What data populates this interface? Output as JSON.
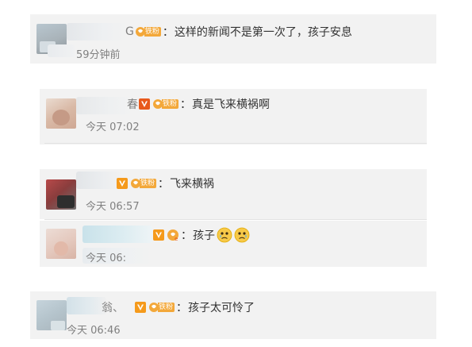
{
  "comments": [
    {
      "name_tail": "G",
      "text": "这样的新闻不是第一次了，孩子安息",
      "time": "59分钟前"
    }
  ],
  "replies": [
    {
      "name_tail": "春",
      "text": "真是飞来横祸啊",
      "time": "今天 07:02"
    },
    {
      "name_tail": "",
      "text": "飞来横祸",
      "time": "今天 06:57"
    },
    {
      "name_tail": "",
      "text": "孩子",
      "time": "今天 06:",
      "emoji": [
        "crying-face",
        "crying-face"
      ]
    },
    {
      "name_tail": "翁、",
      "text": "孩子太可怜了",
      "time": "今天 06:46"
    }
  ],
  "badges": {
    "fan_label": "铁粉",
    "fan_level_mark": "e"
  },
  "punctuation": {
    "colon": "："
  },
  "colors": {
    "panel_bg": "#f2f2f2",
    "text": "#333333",
    "time": "#808080",
    "vip_orange": "#f59a1b",
    "fan_orange": "#f3a83a"
  },
  "icons": [
    "vip-v-icon",
    "fan-badge-icon",
    "crying-face-emoji"
  ]
}
